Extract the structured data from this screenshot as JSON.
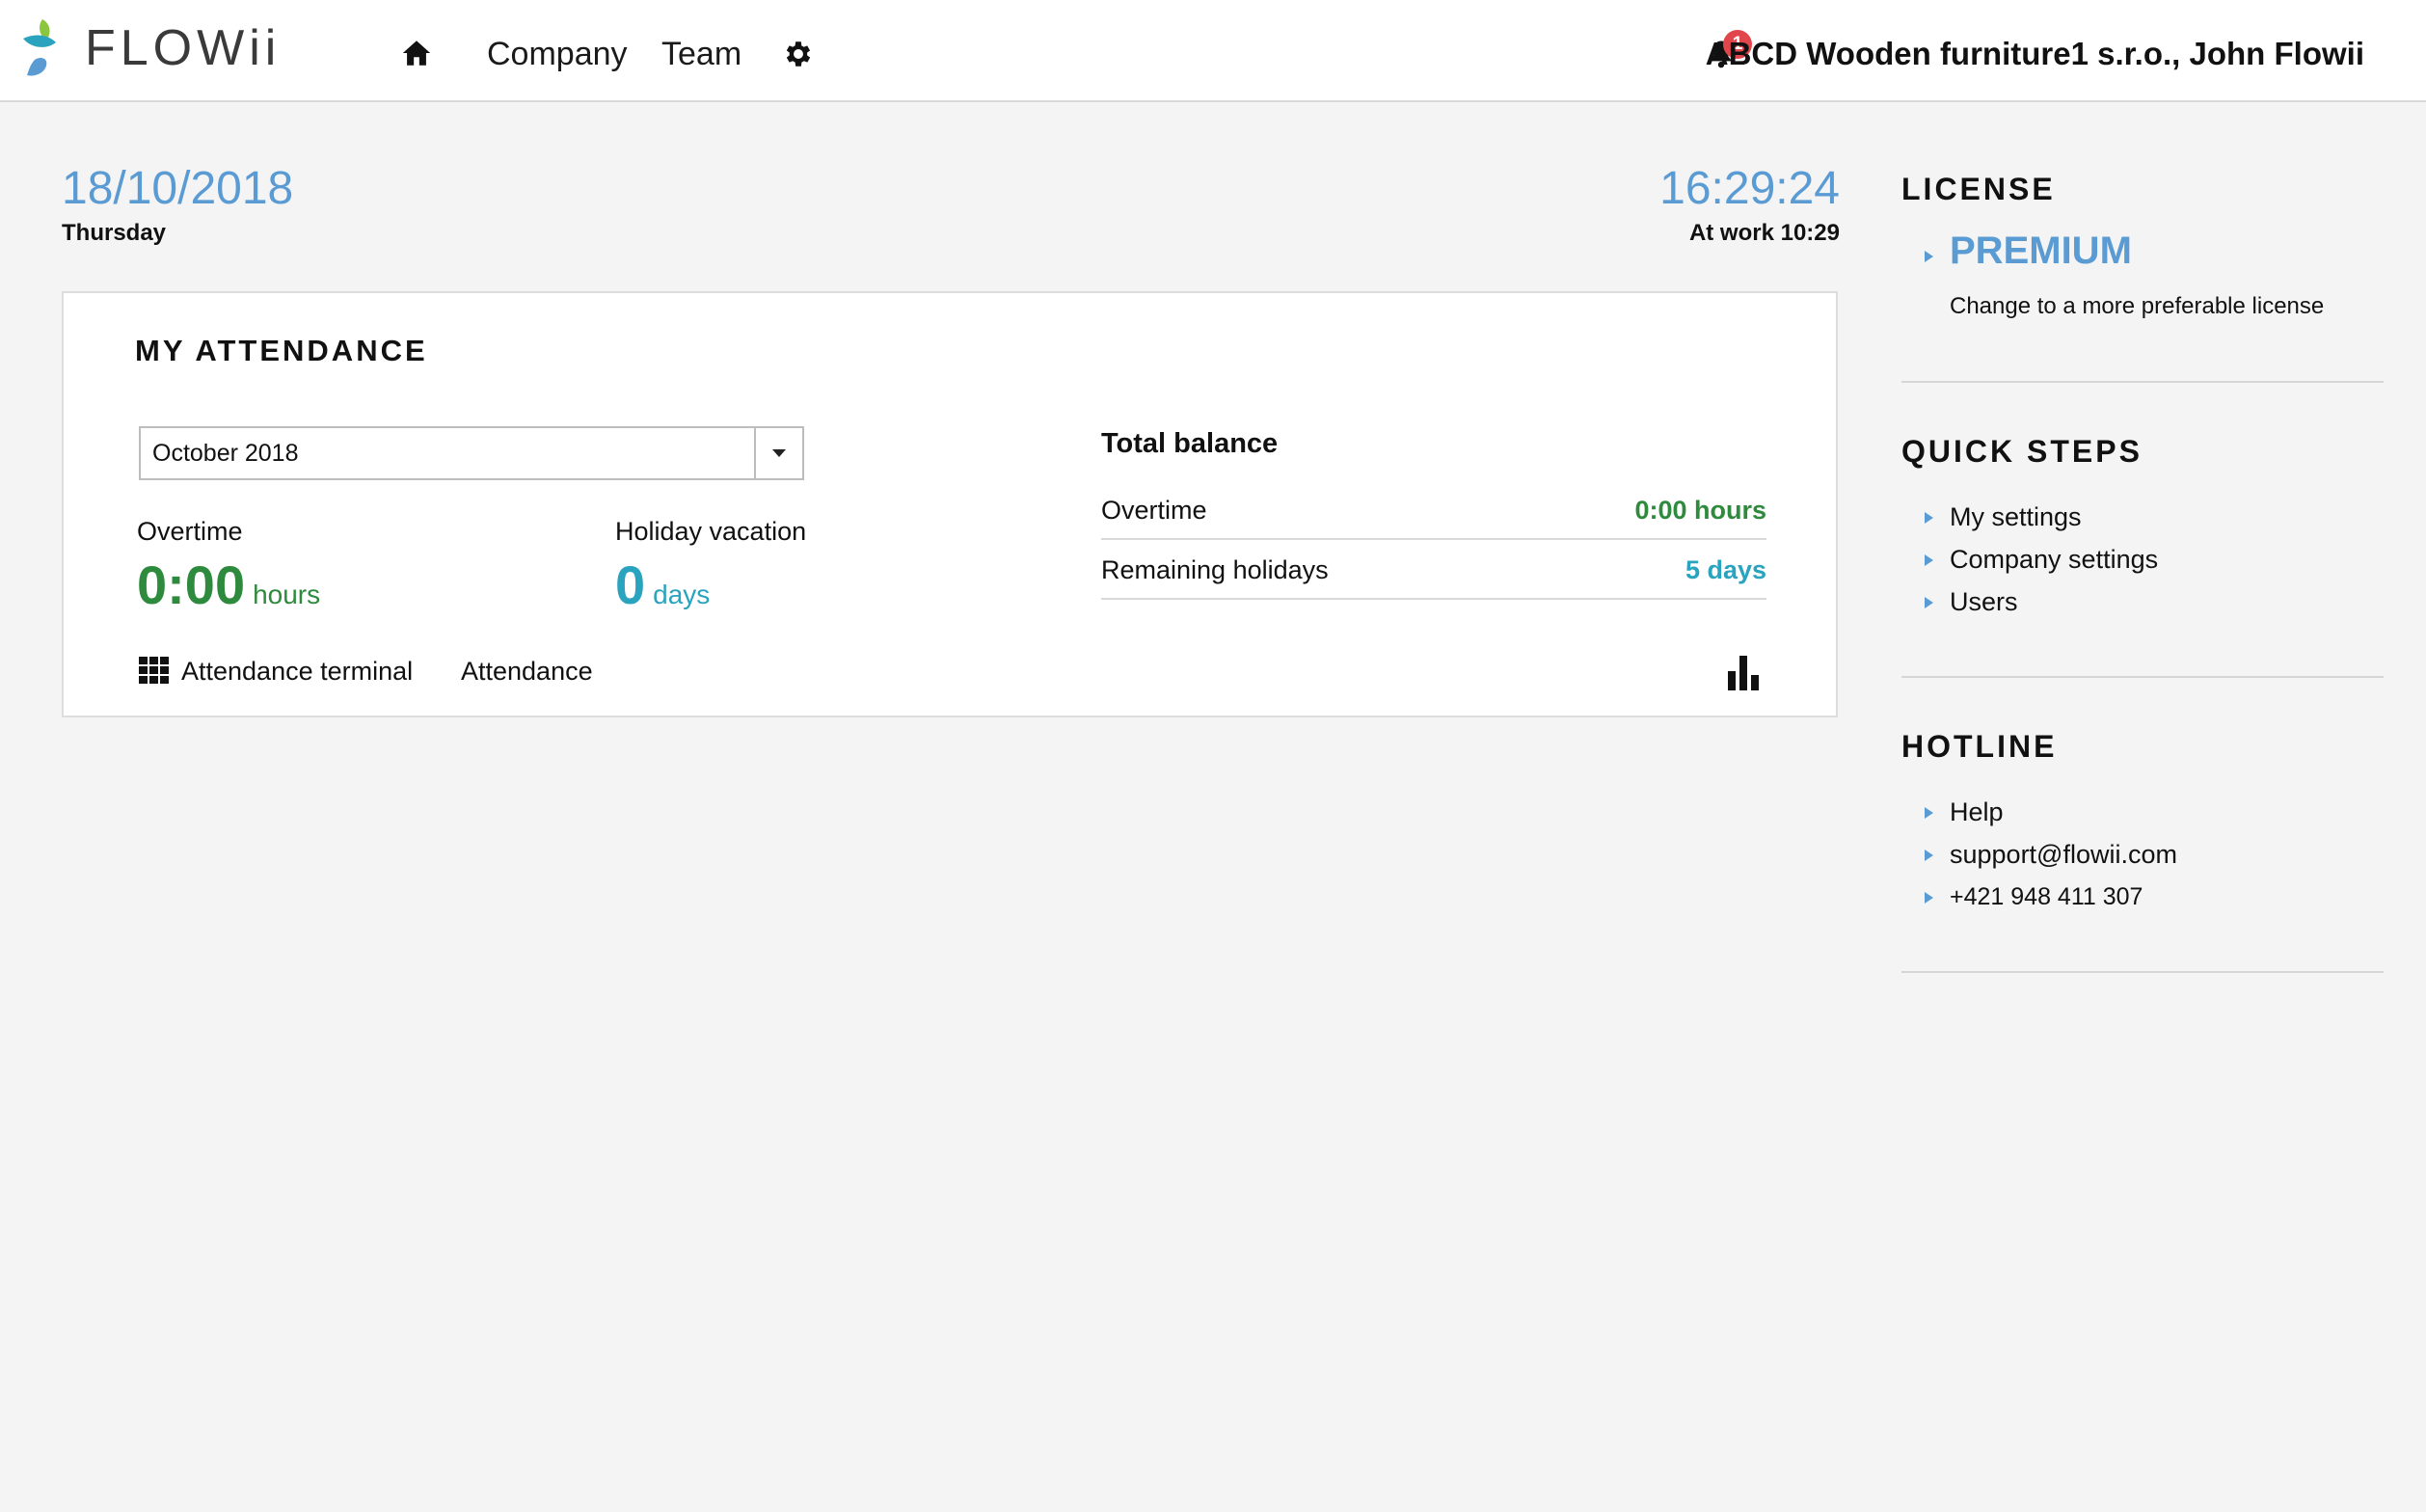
{
  "header": {
    "logo_text": "FLOWii",
    "nav": {
      "company": "Company",
      "team": "Team"
    },
    "notification_count": "1",
    "user": "ABCD Wooden furniture1 s.r.o., John Flowii",
    "icons": [
      "home-icon",
      "gear-icon",
      "bell-icon"
    ]
  },
  "today": {
    "date": "18/10/2018",
    "weekday": "Thursday",
    "time": "16:29:24",
    "at_work": "At work 10:29"
  },
  "attendance": {
    "title": "MY ATTENDANCE",
    "month": "October 2018",
    "overtime_label": "Overtime",
    "overtime_value": "0:00",
    "overtime_unit": "hours",
    "holiday_label": "Holiday vacation",
    "holiday_value": "0",
    "holiday_unit": "days",
    "terminal_link": "Attendance terminal",
    "attendance_link": "Attendance",
    "balance": {
      "title": "Total balance",
      "rows": [
        {
          "label": "Overtime",
          "value": "0:00 hours"
        },
        {
          "label": "Remaining holidays",
          "value": "5 days"
        }
      ]
    }
  },
  "sidebar": {
    "license": {
      "title": "LICENSE",
      "plan": "PREMIUM",
      "change": "Change to a more preferable license"
    },
    "quick_steps": {
      "title": "QUICK STEPS",
      "items": [
        "My settings",
        "Company settings",
        "Users"
      ]
    },
    "hotline": {
      "title": "HOTLINE",
      "items": [
        "Help",
        "support@flowii.com",
        "+421 948 411 307"
      ]
    }
  },
  "colors": {
    "accent_blue": "#5b9bd3",
    "overtime_green": "#2e8b3d",
    "holiday_teal": "#2aa3bf",
    "badge_red": "#e2464d"
  }
}
